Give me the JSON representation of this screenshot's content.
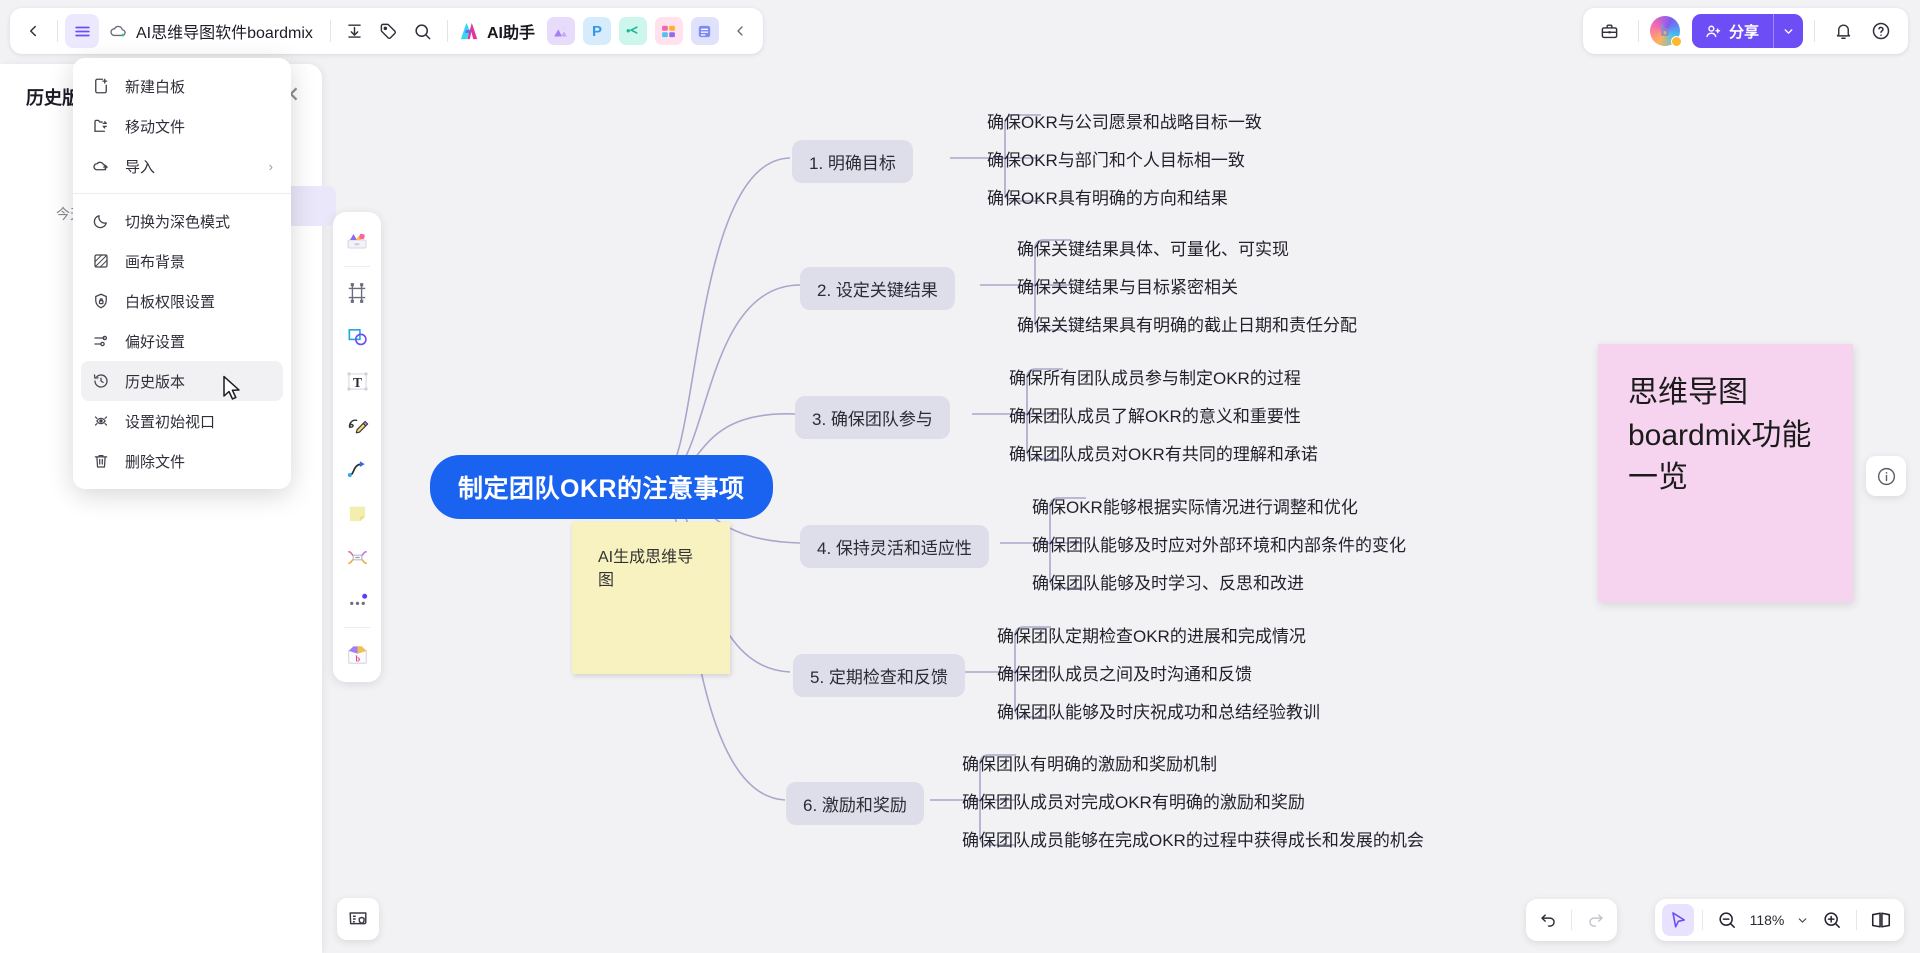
{
  "topbar": {
    "back_icon": "chevron-left-icon",
    "menu_icon": "hamburger-menu-icon",
    "cloud_icon": "cloud-sync-icon",
    "doc_title": "AI思维导图软件boardmix",
    "export_icon": "download-icon",
    "tag_icon": "tag-icon",
    "search_icon": "search-icon",
    "ai_assistant_label": "AI助手",
    "mini_apps": [
      {
        "name": "image-app",
        "glyph": "▲"
      },
      {
        "name": "ppt-app",
        "glyph": "P"
      },
      {
        "name": "mindmap-app",
        "glyph": "C"
      },
      {
        "name": "table-app",
        "glyph": "⊞"
      },
      {
        "name": "doc-app",
        "glyph": "▤"
      }
    ],
    "collapse_icon": "chevron-left-icon",
    "briefcase_icon": "briefcase-icon",
    "avatar_letter": "b",
    "share_label": "分享",
    "share_icon": "add-user-icon",
    "share_caret_icon": "chevron-down-icon",
    "bell_icon": "bell-icon",
    "help_icon": "question-circle-icon"
  },
  "history_panel": {
    "title": "历史版本",
    "close_icon": "close-icon",
    "date_label": "今天"
  },
  "file_menu": {
    "groups": [
      [
        {
          "label": "新建白板",
          "icon": "new-file-icon",
          "arrow": "",
          "highlight": false
        },
        {
          "label": "移动文件",
          "icon": "move-file-icon",
          "arrow": "",
          "highlight": false
        },
        {
          "label": "导入",
          "icon": "cloud-upload-icon",
          "arrow": "›",
          "highlight": false
        }
      ],
      [
        {
          "label": "切换为深色模式",
          "icon": "moon-icon",
          "arrow": "",
          "highlight": false
        },
        {
          "label": "画布背景",
          "icon": "canvas-background-icon",
          "arrow": "",
          "highlight": false
        },
        {
          "label": "白板权限设置",
          "icon": "shield-lock-icon",
          "arrow": "",
          "highlight": false
        },
        {
          "label": "偏好设置",
          "icon": "sliders-icon",
          "arrow": "",
          "highlight": false
        },
        {
          "label": "历史版本",
          "icon": "history-clock-icon",
          "arrow": "",
          "highlight": true
        },
        {
          "label": "设置初始视口",
          "icon": "viewport-eye-icon",
          "arrow": "",
          "highlight": false
        },
        {
          "label": "删除文件",
          "icon": "trash-icon",
          "arrow": "",
          "highlight": false
        }
      ]
    ]
  },
  "left_toolbar": {
    "items": [
      {
        "name": "templates-icon"
      },
      {
        "name": "frame-icon"
      },
      {
        "name": "shape-icon"
      },
      {
        "name": "text-icon"
      },
      {
        "name": "pen-icon"
      },
      {
        "name": "connector-icon"
      },
      {
        "name": "sticky-note-icon"
      },
      {
        "name": "mindmap-icon"
      },
      {
        "name": "more-tools-icon"
      },
      {
        "name": "resource-box-icon"
      }
    ]
  },
  "panel_button": {
    "icon": "board-panel-icon"
  },
  "info_button": {
    "icon": "info-circle-icon"
  },
  "bottom_bar": {
    "undo_icon": "undo-icon",
    "redo_icon": "redo-icon",
    "pointer_icon": "pointer-icon",
    "zoom_out_icon": "zoom-out-icon",
    "zoom_level": "118%",
    "zoom_caret_icon": "chevron-down-icon",
    "zoom_in_icon": "zoom-in-icon",
    "present_icon": "presentation-icon"
  },
  "canvas": {
    "root_node": "制定团队OKR的注意事项",
    "sticky_yellow": "AI生成思维导图",
    "sticky_pink": "思维导图boardmix功能一览",
    "branches": [
      {
        "label": "1. 明确目标",
        "leaves": [
          "确保OKR与公司愿景和战略目标一致",
          "确保OKR与部门和个人目标相一致",
          "确保OKR具有明确的方向和结果"
        ]
      },
      {
        "label": "2. 设定关键结果",
        "leaves": [
          "确保关键结果具体、可量化、可实现",
          "确保关键结果与目标紧密相关",
          "确保关键结果具有明确的截止日期和责任分配"
        ]
      },
      {
        "label": "3. 确保团队参与",
        "leaves": [
          "确保所有团队成员参与制定OKR的过程",
          "确保团队成员了解OKR的意义和重要性",
          "确保团队成员对OKR有共同的理解和承诺"
        ]
      },
      {
        "label": "4. 保持灵活和适应性",
        "leaves": [
          "确保OKR能够根据实际情况进行调整和优化",
          "确保团队能够及时应对外部环境和内部条件的变化",
          "确保团队能够及时学习、反思和改进"
        ]
      },
      {
        "label": "5. 定期检查和反馈",
        "leaves": [
          "确保团队定期检查OKR的进展和完成情况",
          "确保团队成员之间及时沟通和反馈",
          "确保团队能够及时庆祝成功和总结经验教训"
        ]
      },
      {
        "label": "6. 激励和奖励",
        "leaves": [
          "确保团队有明确的激励和奖励机制",
          "确保团队成员对完成OKR有明确的激励和奖励",
          "确保团队成员能够在完成OKR的过程中获得成长和发展的机会"
        ]
      }
    ]
  },
  "colors": {
    "accent": "#6c4df6",
    "root_node": "#1a63f0",
    "branch_node": "#dedeea",
    "canvas_bg": "#f2f2f5",
    "sticky_yellow": "#f7f2c0",
    "sticky_pink": "#f6d4ef",
    "connector": "#a9a6cc"
  }
}
